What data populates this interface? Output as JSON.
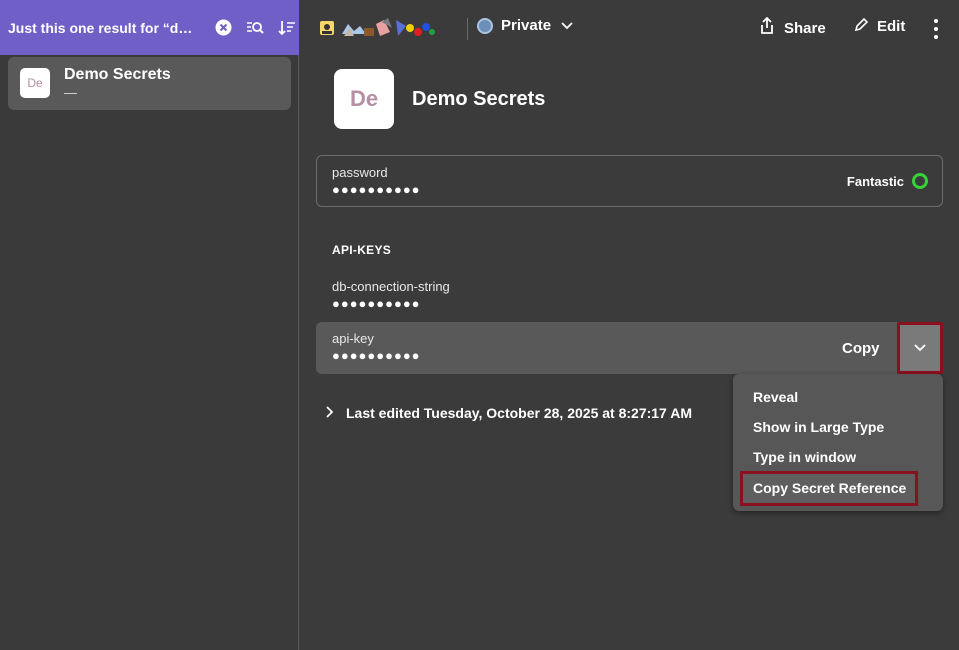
{
  "search": {
    "text": "Just this one result for “demo secrets”"
  },
  "result": {
    "avatar": "De",
    "title": "Demo Secrets",
    "subtitle": "—"
  },
  "topbar": {
    "privacy": "Private",
    "share": "Share",
    "edit": "Edit"
  },
  "item": {
    "avatar": "De",
    "title": "Demo Secrets"
  },
  "password": {
    "label": "password",
    "dots": "●●●●●●●●●●",
    "strength": "Fantastic"
  },
  "section": {
    "title": "API-KEYS"
  },
  "db": {
    "label": "db-connection-string",
    "dots": "●●●●●●●●●●"
  },
  "api": {
    "label": "api-key",
    "dots": "●●●●●●●●●●",
    "copy": "Copy"
  },
  "last_edited": "Last edited Tuesday, October 28, 2025 at 8:27:17 AM",
  "menu": {
    "items": [
      "Reveal",
      "Show in Large Type",
      "Type in window",
      "Copy Secret Reference"
    ]
  },
  "colors": {
    "accent": "#6f5fc7",
    "highlight_border": "#8a0f1f",
    "strength_ok": "#35d23b"
  }
}
